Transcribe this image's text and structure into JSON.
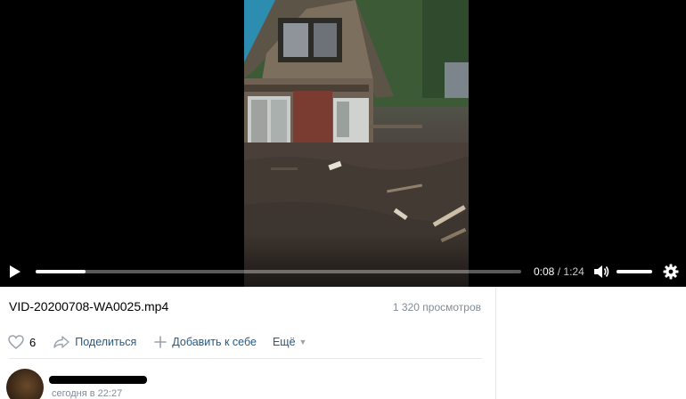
{
  "player": {
    "current_time": "0:08",
    "separator": "/",
    "duration": "1:24",
    "progress_fraction": 0.103,
    "volume_fraction": 1.0,
    "play_icon": "play-icon",
    "volume_icon": "volume-icon",
    "settings_icon": "gear-icon"
  },
  "video": {
    "title": "VID-20200708-WA0025.mp4",
    "views": "1 320 просмотров"
  },
  "actions": {
    "like_count": "6",
    "share_label": "Поделиться",
    "add_label": "Добавить к себе",
    "more_label": "Ещё"
  },
  "comment": {
    "date": "сегодня в 22:27"
  },
  "colors": {
    "link": "#2a5885",
    "muted": "#818c99"
  }
}
